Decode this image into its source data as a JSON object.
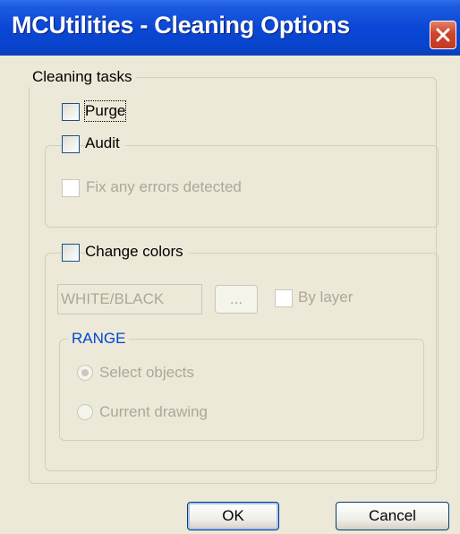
{
  "window": {
    "title": "MCUtilities - Cleaning Options"
  },
  "cleaning_tasks": {
    "legend": "Cleaning tasks",
    "purge_label": "Purge",
    "purge_checked": false,
    "audit_label": "Audit",
    "audit_checked": false,
    "fix_errors_label": "Fix any errors detected",
    "fix_errors_checked": false
  },
  "change_colors": {
    "label": "Change colors",
    "checked": false,
    "color_value": "WHITE/BLACK",
    "browse_label": "...",
    "by_layer_label": "By layer",
    "by_layer_checked": false
  },
  "range": {
    "legend": "RANGE",
    "options": [
      "Select objects",
      "Current drawing"
    ],
    "selected": "Select objects"
  },
  "buttons": {
    "ok_label": "OK",
    "cancel_label": "Cancel"
  },
  "colors": {
    "title_bar": "#0A47D6",
    "dialog_bg": "#ECE9D8",
    "accent_blue": "#0046D5",
    "disabled_text": "#ACA899",
    "close_button": "#D0432A"
  }
}
